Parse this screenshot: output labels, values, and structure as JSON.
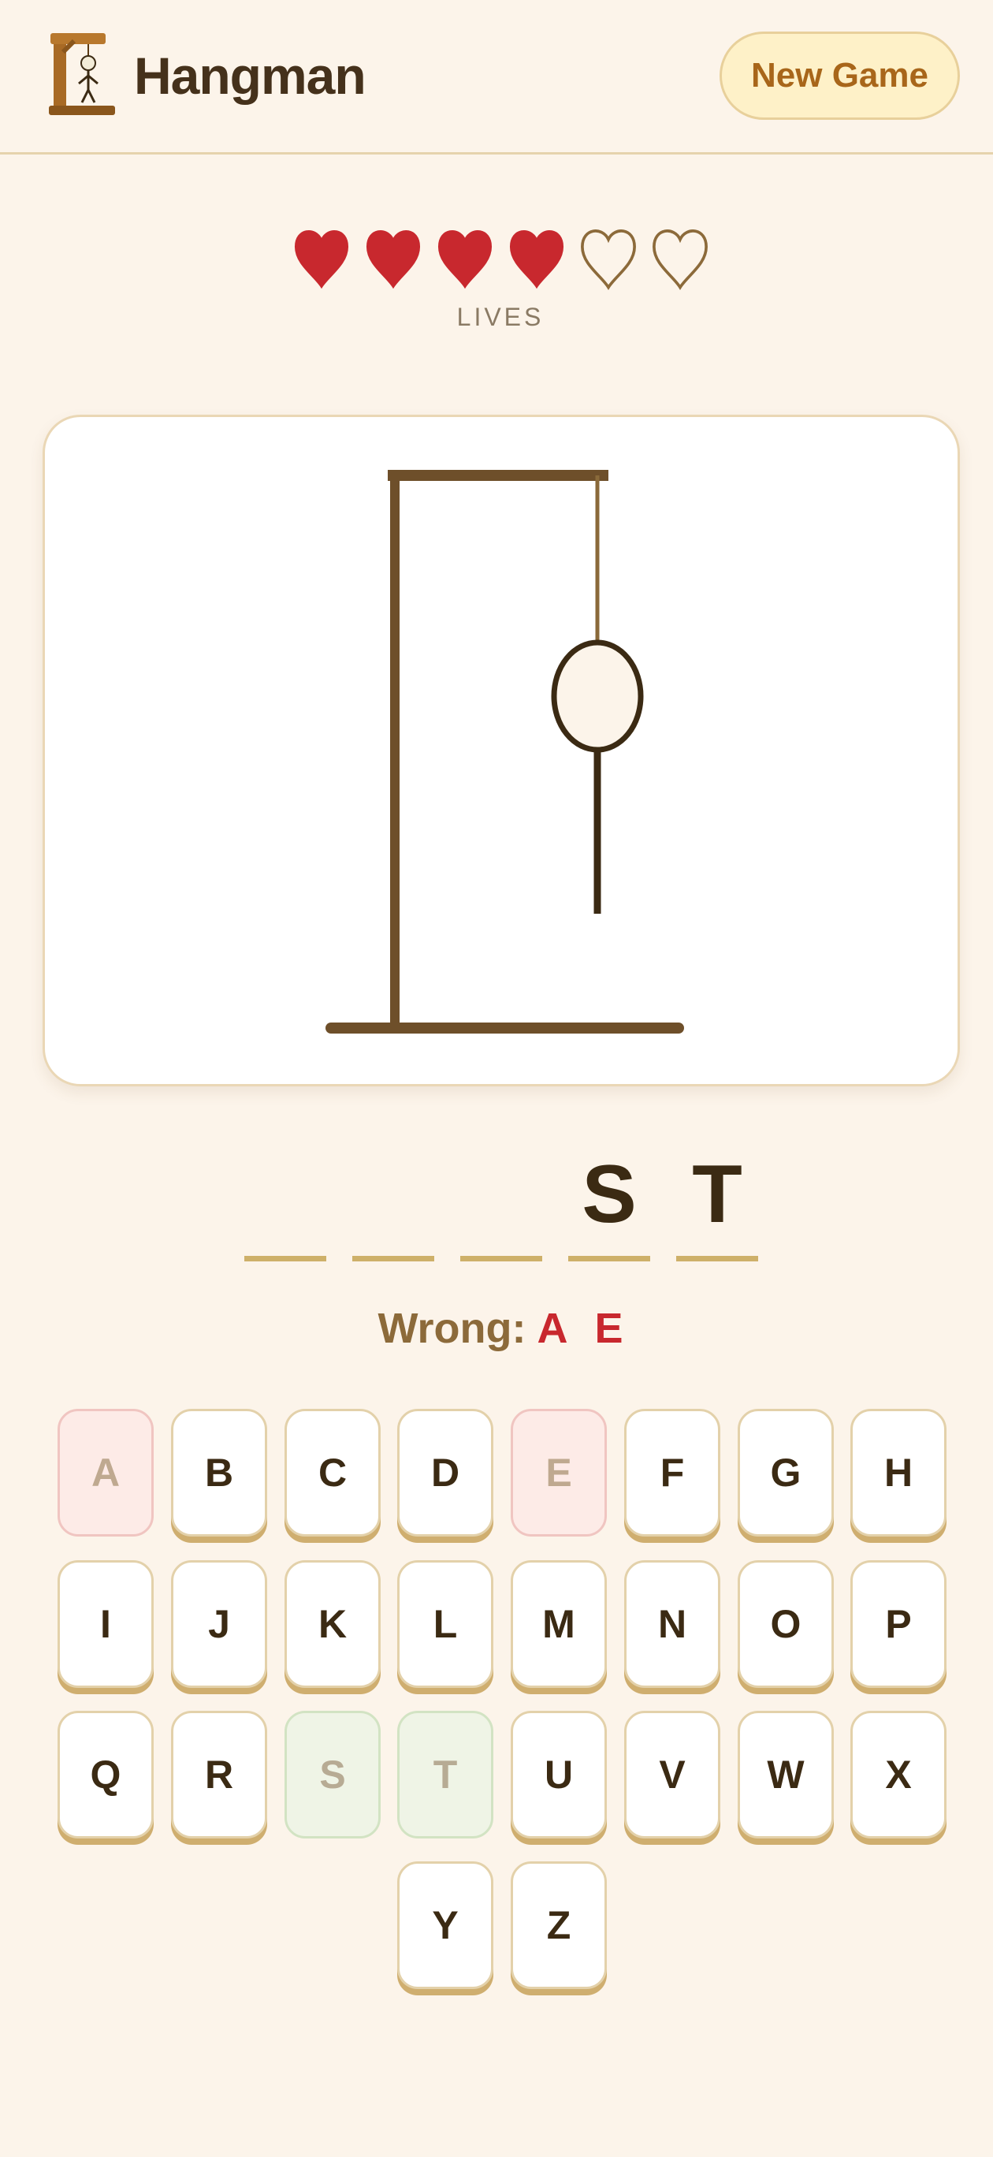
{
  "app": {
    "title": "Hangman",
    "new_game_label": "New Game"
  },
  "lives": {
    "label": "LIVES",
    "total": 6,
    "remaining": 4
  },
  "word": {
    "letters": [
      "",
      "",
      "",
      "S",
      "T"
    ]
  },
  "wrong_guesses": {
    "label": "Wrong:",
    "letters": [
      "A",
      "E"
    ]
  },
  "keyboard": {
    "rows": [
      [
        "A",
        "B",
        "C",
        "D",
        "E",
        "F",
        "G",
        "H"
      ],
      [
        "I",
        "J",
        "K",
        "L",
        "M",
        "N",
        "O",
        "P"
      ],
      [
        "Q",
        "R",
        "S",
        "T",
        "U",
        "V",
        "W",
        "X"
      ],
      [
        "Y",
        "Z"
      ]
    ],
    "wrong_letters": [
      "A",
      "E"
    ],
    "correct_letters": [
      "S",
      "T"
    ]
  },
  "hangman": {
    "parts_shown": [
      "gallows",
      "head",
      "body"
    ]
  },
  "colors": {
    "background": "#fcf4ea",
    "heart_full": "#c8282e",
    "heart_empty": "#8c6a3a",
    "gallows": "#6e4f2a",
    "figure": "#3b2a13",
    "button_text": "#a8661a"
  }
}
